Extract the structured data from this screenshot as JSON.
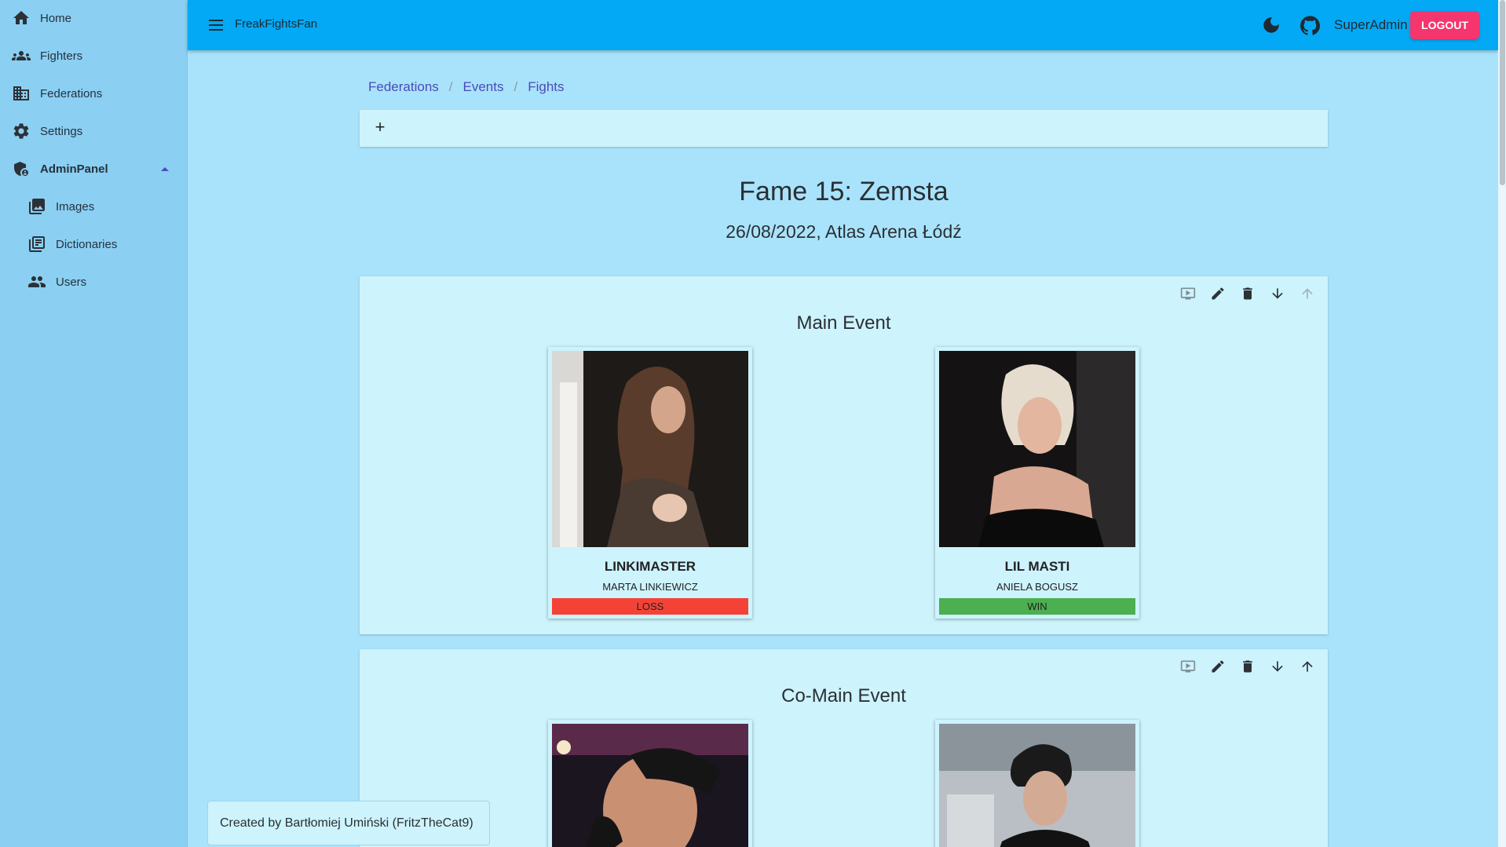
{
  "sidebar": {
    "items": [
      {
        "label": "Home",
        "icon": "home-icon"
      },
      {
        "label": "Fighters",
        "icon": "groups-icon"
      },
      {
        "label": "Federations",
        "icon": "domain-icon"
      },
      {
        "label": "Settings",
        "icon": "gear-icon"
      },
      {
        "label": "AdminPanel",
        "icon": "admin-shield-icon"
      },
      {
        "label": "Images",
        "icon": "photo-library-icon"
      },
      {
        "label": "Dictionaries",
        "icon": "library-books-icon"
      },
      {
        "label": "Users",
        "icon": "people-icon"
      }
    ]
  },
  "topbar": {
    "app_title": "FreakFightsFan",
    "user": "SuperAdmin",
    "logout": "LOGOUT"
  },
  "breadcrumb": [
    "Federations",
    "Events",
    "Fights"
  ],
  "add_label": "+",
  "event": {
    "title": "Fame 15: Zemsta",
    "subtitle": "26/08/2022, Atlas Arena Łódź"
  },
  "fights": [
    {
      "label": "Main Event",
      "fighters": [
        {
          "nickname": "LINKIMASTER",
          "name": "MARTA LINKIEWICZ",
          "result": "LOSS",
          "result_color": "#f44336"
        },
        {
          "nickname": "LIL MASTI",
          "name": "ANIELA BOGUSZ",
          "result": "WIN",
          "result_color": "#4caf50"
        }
      ]
    },
    {
      "label": "Co-Main Event",
      "fighters": [
        {
          "nickname": "",
          "name": "",
          "result": ""
        },
        {
          "nickname": "",
          "name": "",
          "result": ""
        }
      ]
    }
  ],
  "footer": "Created by Bartłomiej Umiński (FritzTheCat9)",
  "colors": {
    "topbar": "#03a9f4",
    "sidebar": "#8bcff3",
    "background": "#a9e3fb",
    "card": "#cdf3fd",
    "logout": "#f5366e",
    "loss": "#f44336",
    "win": "#4caf50"
  }
}
